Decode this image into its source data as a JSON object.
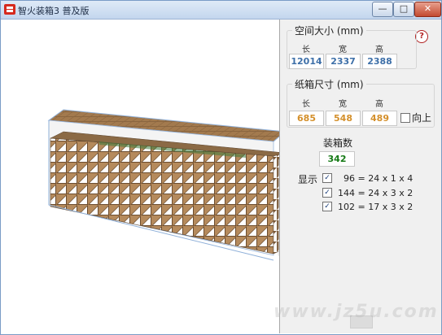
{
  "window": {
    "title": "智火装箱3 普及版",
    "minimize": "—",
    "maximize": "□",
    "close": "✕"
  },
  "space": {
    "label": "空间大小 (mm)",
    "headers": [
      "长",
      "宽",
      "高"
    ],
    "values": [
      "12014",
      "2337",
      "2388"
    ]
  },
  "carton": {
    "label": "纸箱尺寸 (mm)",
    "headers": [
      "长",
      "宽",
      "高"
    ],
    "values": [
      "685",
      "548",
      "489"
    ],
    "upright_label": "向上",
    "upright_checked": false
  },
  "count": {
    "label": "装箱数",
    "value": "342"
  },
  "display": {
    "label": "显示",
    "rows": [
      {
        "checked": true,
        "text": "96 = 24 x 1 x 4"
      },
      {
        "checked": true,
        "text": "144 = 24 x 3 x 2"
      },
      {
        "checked": true,
        "text": "102 = 17 x 3 x 2"
      }
    ]
  },
  "help": "?",
  "watermark": "www.jz5u.com",
  "colors": {
    "blue_value": "#3d6fa8",
    "orange_value": "#d4902c",
    "green_value": "#167a16",
    "box_top": "#7a5a38",
    "box_light": "#ffffff",
    "box_dark": "#5a4028"
  }
}
